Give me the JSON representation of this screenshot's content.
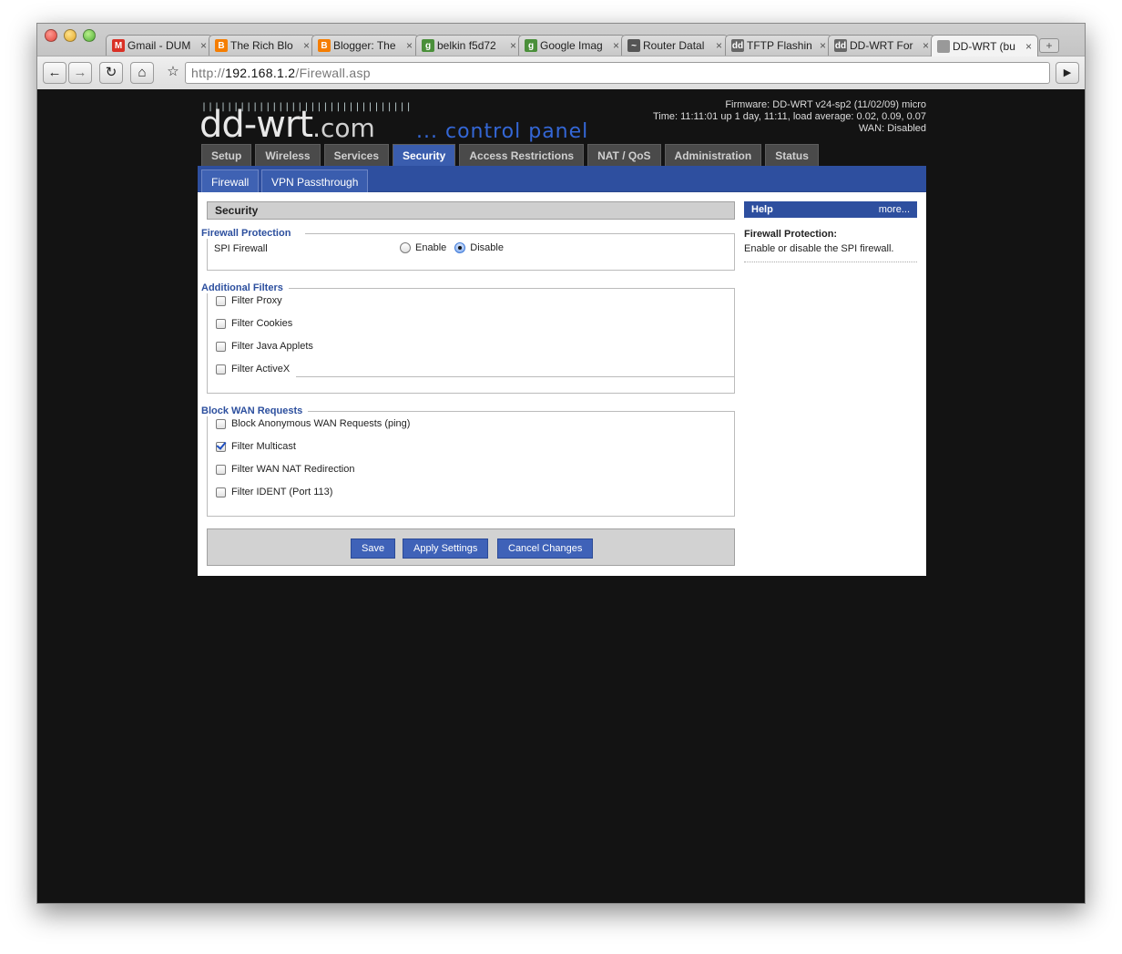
{
  "browser": {
    "tabs": [
      {
        "label": "Gmail - DUM",
        "icon": "gmail-icon",
        "color": "#d93025",
        "glyph": "M"
      },
      {
        "label": "The Rich Blo",
        "icon": "blogger-icon",
        "color": "#f57d00",
        "glyph": "B"
      },
      {
        "label": "Blogger: The",
        "icon": "blogger-icon",
        "color": "#f57d00",
        "glyph": "B"
      },
      {
        "label": "belkin f5d72",
        "icon": "google-icon",
        "color": "#4a8f3a",
        "glyph": "g"
      },
      {
        "label": "Google Imag",
        "icon": "google-icon",
        "color": "#4a8f3a",
        "glyph": "g"
      },
      {
        "label": "Router Datal",
        "icon": "router-db-icon",
        "color": "#555555",
        "glyph": "~"
      },
      {
        "label": "TFTP Flashin",
        "icon": "ddwrt-icon",
        "color": "#666666",
        "glyph": "dd"
      },
      {
        "label": "DD-WRT For",
        "icon": "ddwrt-icon",
        "color": "#666666",
        "glyph": "dd"
      },
      {
        "label": "DD-WRT (bu",
        "icon": "page-icon",
        "color": "#999999",
        "glyph": ""
      }
    ],
    "url_prefix": "http://",
    "url_host": "192.168.1.2",
    "url_path": "/Firewall.asp"
  },
  "header": {
    "logo": "dd-wrt",
    "logo_suffix": ".com",
    "tagline": "... control panel",
    "firmware": "Firmware: DD-WRT v24-sp2 (11/02/09) micro",
    "time": "Time: 11:11:01 up 1 day, 11:11, load average: 0.02, 0.09, 0.07",
    "wan": "WAN: Disabled"
  },
  "main_tabs": [
    "Setup",
    "Wireless",
    "Services",
    "Security",
    "Access Restrictions",
    "NAT / QoS",
    "Administration",
    "Status"
  ],
  "active_main_tab": "Security",
  "sub_tabs": [
    "Firewall",
    "VPN Passthrough"
  ],
  "section_title": "Security",
  "firewall": {
    "legend": "Firewall Protection",
    "spi_label": "SPI Firewall",
    "enable_label": "Enable",
    "disable_label": "Disable",
    "selected": "Disable"
  },
  "additional": {
    "legend": "Additional Filters",
    "items": [
      {
        "label": "Filter Proxy",
        "checked": false
      },
      {
        "label": "Filter Cookies",
        "checked": false
      },
      {
        "label": "Filter Java Applets",
        "checked": false
      },
      {
        "label": "Filter ActiveX",
        "checked": false
      }
    ]
  },
  "wan": {
    "legend": "Block WAN Requests",
    "items": [
      {
        "label": "Block Anonymous WAN Requests (ping)",
        "checked": false
      },
      {
        "label": "Filter Multicast",
        "checked": true
      },
      {
        "label": "Filter WAN NAT Redirection",
        "checked": false
      },
      {
        "label": "Filter IDENT (Port 113)",
        "checked": false
      }
    ]
  },
  "buttons": {
    "save": "Save",
    "apply": "Apply Settings",
    "cancel": "Cancel Changes"
  },
  "help": {
    "title": "Help",
    "more": "more...",
    "heading": "Firewall Protection:",
    "text": "Enable or disable the SPI firewall."
  }
}
